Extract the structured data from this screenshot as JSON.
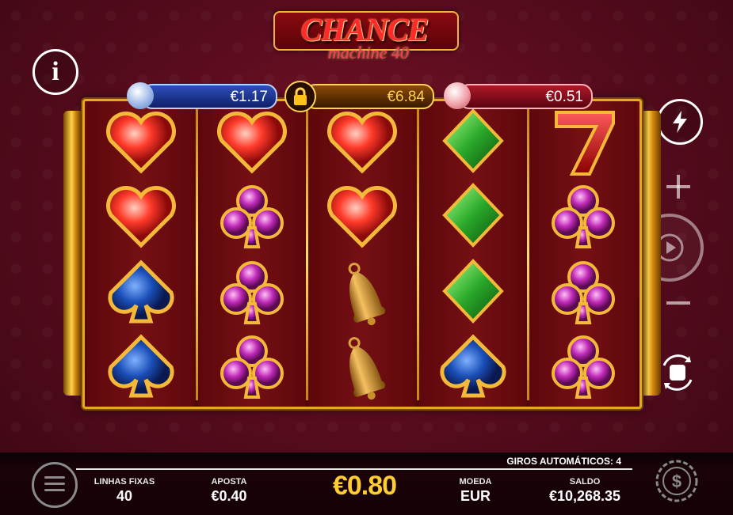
{
  "logo": {
    "main": "CHANCE",
    "sub": "machine 40"
  },
  "jackpots": [
    {
      "value": "€1.17",
      "tier": "blue"
    },
    {
      "value": "€6.84",
      "tier": "gold"
    },
    {
      "value": "€0.51",
      "tier": "red"
    }
  ],
  "icons": {
    "info": "info-icon",
    "turbo": "lightning-icon",
    "plus": "plus-icon",
    "minus": "minus-icon",
    "spin": "play-icon",
    "autoplay": "autoplay-stop-icon",
    "menu": "hamburger-icon",
    "cashier": "coin-dollar-icon",
    "lock": "lock-icon"
  },
  "info_glyph": "i",
  "reels": [
    [
      "heart",
      "heart",
      "spade",
      "spade"
    ],
    [
      "heart",
      "club",
      "club",
      "club"
    ],
    [
      "heart",
      "heart",
      "bell",
      "bell"
    ],
    [
      "diamond",
      "diamond",
      "diamond",
      "spade"
    ],
    [
      "seven",
      "club",
      "club",
      "club"
    ]
  ],
  "footer": {
    "autospins": "GIROS AUTOMÁTICOS: 4",
    "lines_label": "LINHAS FIXAS",
    "lines_value": "40",
    "bet_label": "APOSTA",
    "bet_value": "€0.40",
    "total": "€0.80",
    "currency_label": "MOEDA",
    "currency_value": "EUR",
    "balance_label": "SALDO",
    "balance_value": "€10,268.35"
  },
  "colors": {
    "accent_gold": "#ffcc33",
    "background": "#5a0c1e",
    "heart": "#ff3a2a",
    "spade": "#1a4fb8",
    "club": "#c02ab8",
    "diamond": "#2aa82a"
  }
}
